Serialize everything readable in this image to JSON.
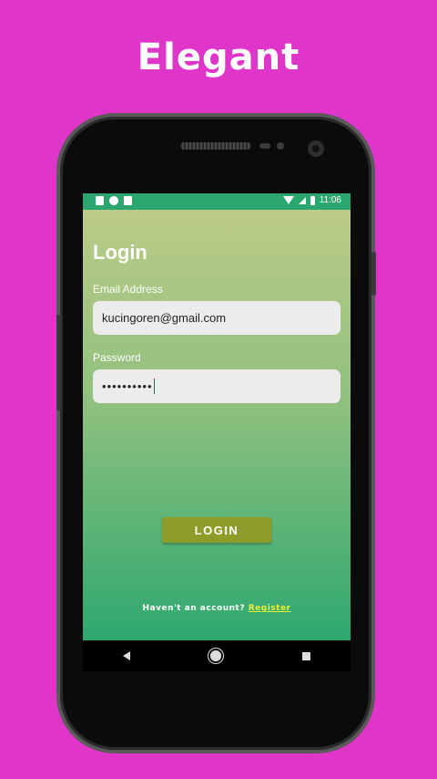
{
  "headline": "Elegant",
  "status_bar": {
    "time": "11:06",
    "left_icons": [
      "notification-a-icon",
      "notification-dot-icon",
      "sd-card-icon"
    ],
    "right_icons": [
      "wifi-icon",
      "signal-icon",
      "battery-icon"
    ]
  },
  "screen": {
    "title": "Login",
    "email": {
      "label": "Email Address",
      "value": "kucingoren@gmail.com"
    },
    "password": {
      "label": "Password",
      "value": "••••••••••"
    },
    "login_button": "LOGIN",
    "register_prompt": "Haven't an account?",
    "register_link": "Register"
  },
  "nav_bar": {
    "buttons": [
      "back-icon",
      "home-icon",
      "recents-icon"
    ]
  },
  "colors": {
    "background": "#e035c9",
    "status_bar": "#2ba66f",
    "gradient_top": "#bccb87",
    "gradient_bottom": "#2ea86f",
    "button": "#8e9d2a",
    "link": "#e5f23a"
  }
}
